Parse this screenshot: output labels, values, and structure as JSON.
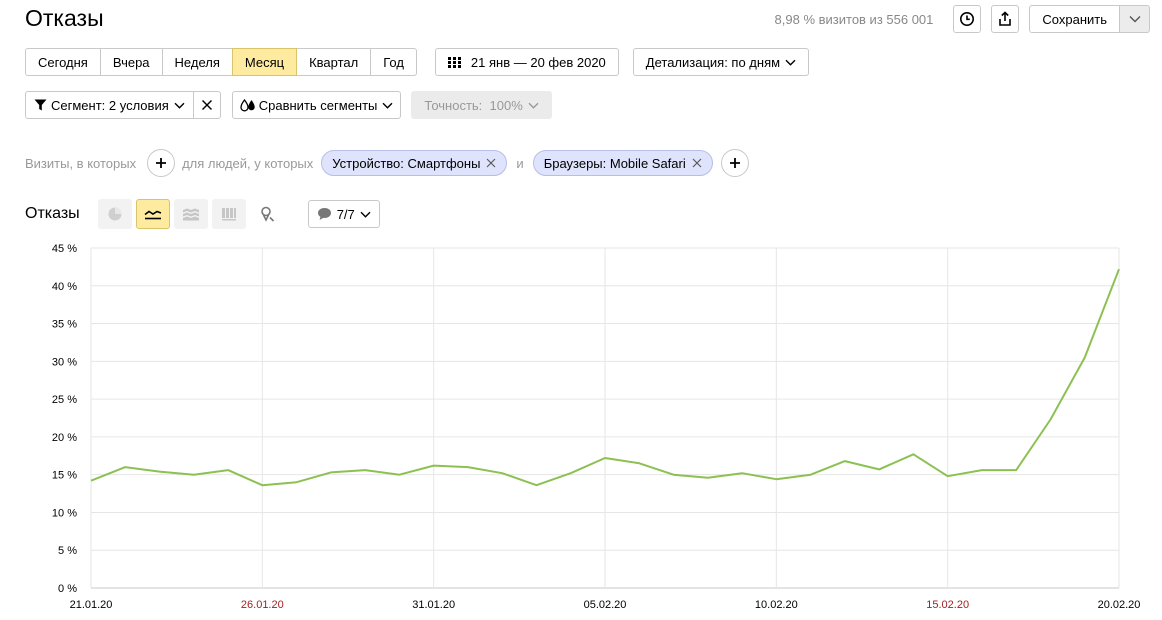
{
  "header": {
    "title": "Отказы",
    "visits_info": "8,98 % визитов из 556 001",
    "save_label": "Сохранить"
  },
  "periods": [
    "Сегодня",
    "Вчера",
    "Неделя",
    "Месяц",
    "Квартал",
    "Год"
  ],
  "active_period": "Месяц",
  "date_range": "21 янв — 20 фев 2020",
  "detail_label": "Детализация: по дням",
  "segment_label": "Сегмент: 2 условия",
  "compare_label": "Сравнить сегменты",
  "accuracy_label": "Точность:  100%",
  "filter": {
    "visits_text": "Визиты, в которых",
    "people_text": "для людей, у которых",
    "and_text": "и",
    "chips": [
      "Устройство: Смартфоны",
      "Браузеры: Mobile Safari"
    ]
  },
  "chart_header": {
    "title": "Отказы",
    "notes_label": "7/7"
  },
  "colors": {
    "line": "#8cc152",
    "grid": "#e6e6e6",
    "active": "#ffeba0",
    "weekend_label": "#a12222",
    "chip_bg": "#dfe3fb"
  },
  "chart_data": {
    "type": "line",
    "title": "",
    "xlabel": "",
    "ylabel": "",
    "ylim": [
      0,
      45
    ],
    "yticks": [
      0,
      5,
      10,
      15,
      20,
      25,
      30,
      35,
      40,
      45
    ],
    "ytick_labels": [
      "0 %",
      "5 %",
      "10 %",
      "15 %",
      "20 %",
      "25 %",
      "30 %",
      "35 %",
      "40 %",
      "45 %"
    ],
    "x": [
      "21.01.20",
      "22.01.20",
      "23.01.20",
      "24.01.20",
      "25.01.20",
      "26.01.20",
      "27.01.20",
      "28.01.20",
      "29.01.20",
      "30.01.20",
      "31.01.20",
      "01.02.20",
      "02.02.20",
      "03.02.20",
      "04.02.20",
      "05.02.20",
      "06.02.20",
      "07.02.20",
      "08.02.20",
      "09.02.20",
      "10.02.20",
      "11.02.20",
      "12.02.20",
      "13.02.20",
      "14.02.20",
      "15.02.20",
      "16.02.20",
      "17.02.20",
      "18.02.20",
      "19.02.20",
      "20.02.20"
    ],
    "xtick_labels": [
      "21.01.20",
      "26.01.20",
      "31.01.20",
      "05.02.20",
      "10.02.20",
      "15.02.20",
      "20.02.20"
    ],
    "weekend_ticks": [
      "26.01.20",
      "15.02.20"
    ],
    "values": [
      14.2,
      16.0,
      15.4,
      15.0,
      15.6,
      13.6,
      14.0,
      15.3,
      15.6,
      15.0,
      16.2,
      16.0,
      15.2,
      13.6,
      15.2,
      17.2,
      16.5,
      15.0,
      14.6,
      15.2,
      14.4,
      15.0,
      16.8,
      15.7,
      17.7,
      14.8,
      15.6,
      15.6,
      22.3,
      30.5,
      42.2
    ],
    "grid": true
  }
}
